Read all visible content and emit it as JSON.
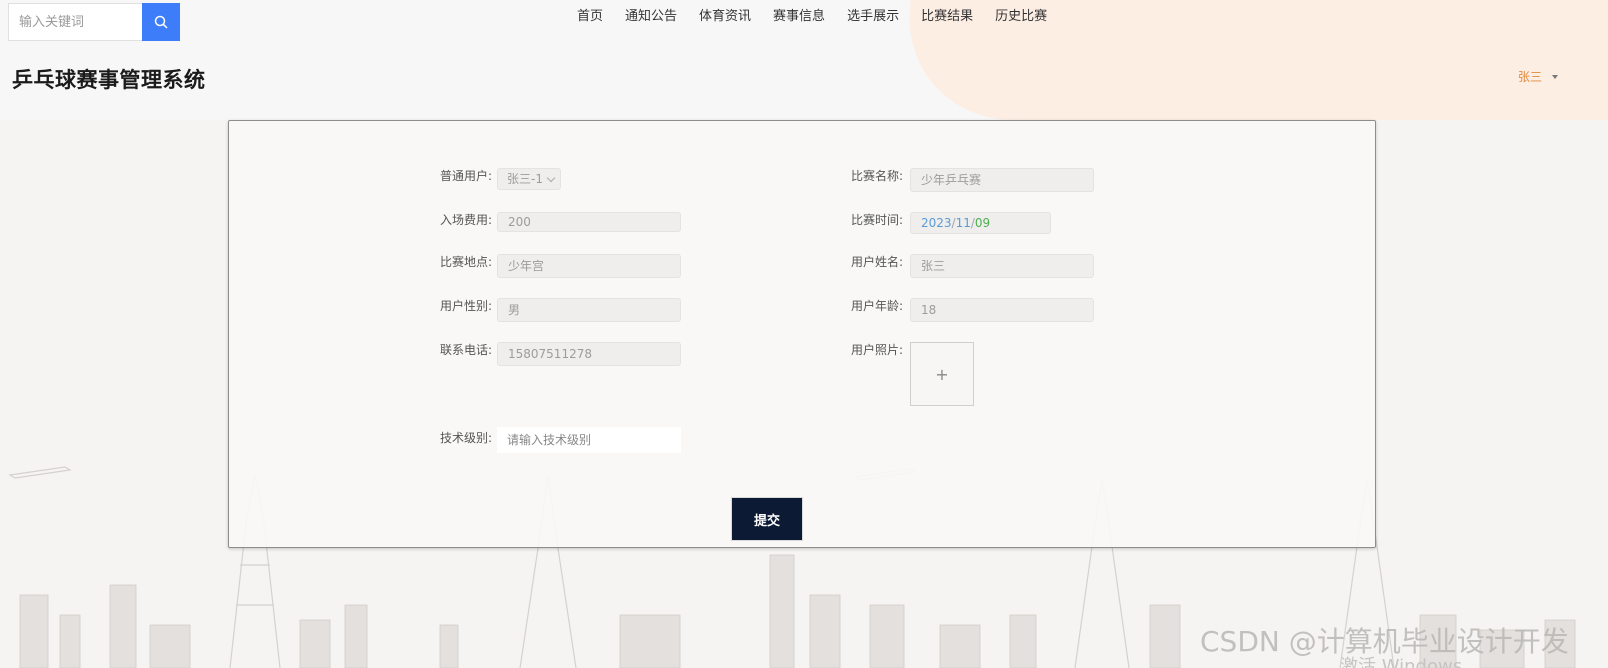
{
  "search": {
    "placeholder": "输入关键词"
  },
  "nav": [
    "首页",
    "通知公告",
    "体育资讯",
    "赛事信息",
    "选手展示",
    "比赛结果",
    "历史比赛"
  ],
  "site_title": "乒乓球赛事管理系统",
  "user": {
    "name": "张三"
  },
  "form": {
    "labels": {
      "user": "普通用户:",
      "match_name": "比赛名称:",
      "fee": "入场费用:",
      "match_time": "比赛时间:",
      "venue": "比赛地点:",
      "user_name": "用户姓名:",
      "gender": "用户性别:",
      "age": "用户年龄:",
      "phone": "联系电话:",
      "photo": "用户照片:",
      "level": "技术级别:"
    },
    "values": {
      "user": "张三-1",
      "match_name": "少年乒乓赛",
      "fee": "200",
      "date_year": "2023",
      "date_month": "11",
      "date_day": "09",
      "venue": "少年宫",
      "user_name": "张三",
      "gender": "男",
      "age": "18",
      "phone": "15807511278"
    },
    "upload_symbol": "+",
    "level_placeholder": "请输入技术级别",
    "submit_label": "提交"
  },
  "watermark": "CSDN @计算机毕业设计开发",
  "watermark_sub": "激活 Windows",
  "colors": {
    "accent": "#3d7dfa",
    "submit_bg": "#0c1a33",
    "user_name": "#e08a3a"
  }
}
